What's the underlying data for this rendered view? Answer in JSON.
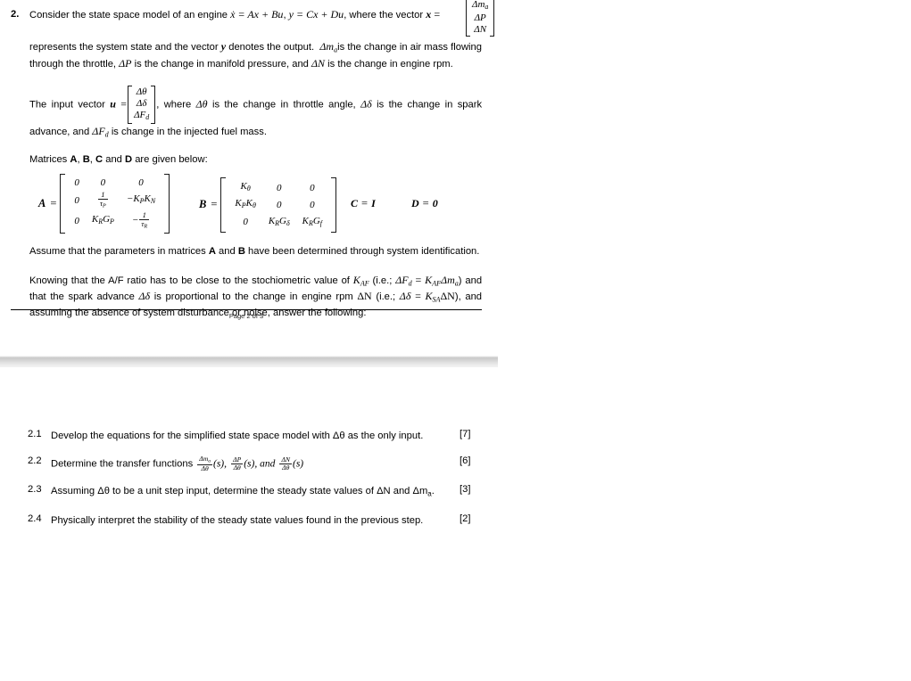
{
  "document": {
    "question_number": "2.",
    "intro": {
      "before_vector": "Consider the state space model of an engine",
      "eq1": "ẋ = Ax + Bu",
      "eq2": "y = Cx + Du",
      "after_eq": ", where the vector",
      "x_symbol": "x",
      "equals": "=",
      "state_vector": [
        "Δm",
        "ΔP",
        "ΔN"
      ],
      "state_vector_sub": "a"
    },
    "paragraph_state": {
      "text_1": "represents the system state and the vector",
      "y_symbol": "y",
      "text_2": "denotes the output.",
      "dma": "Δm",
      "dma_sub": "a",
      "text_3": "is the change in air mass flowing through the throttle,",
      "dP": "ΔP",
      "text_4": "is the change in manifold pressure, and",
      "dN": "ΔN",
      "text_5": "is the change in engine rpm."
    },
    "paragraph_input": {
      "text_1": "The input vector",
      "u_symbol": "u",
      "equals": "=",
      "input_vector": [
        "Δθ",
        "Δδ",
        "ΔF"
      ],
      "input_vector_sub": "d",
      "text_2": ", where",
      "dtheta": "Δθ",
      "text_3": "is the change in throttle angle,",
      "ddelta": "Δδ",
      "text_4": "is the change in spark advance, and",
      "dFd": "ΔF",
      "dFd_sub": "d",
      "text_5": "is change in the injected fuel mass."
    },
    "matrices_intro": {
      "text_1": "Matrices",
      "A": "A",
      "sep_1": ",",
      "B": "B",
      "sep_2": ",",
      "C": "C",
      "and": "and",
      "D": "D",
      "text_2": "are given below:"
    },
    "matrix_A": {
      "label": "A",
      "equals": "=",
      "rows": [
        [
          "0",
          "0",
          "0"
        ],
        [
          "0",
          "1/τ_P",
          "−K_P K_N"
        ],
        [
          "0",
          "K_R G_P",
          "−1/τ_R"
        ]
      ],
      "cells": {
        "r1": [
          "0",
          "0",
          "0"
        ],
        "r2c1": "0",
        "r2c2_num": "1",
        "r2c2_den": "τ",
        "r2c2_den_sub": "P",
        "r2c3": "−K",
        "r2c3_sub1": "P",
        "r2c3_b": "K",
        "r2c3_sub2": "N",
        "r3c1": "0",
        "r3c2": "K",
        "r3c2_sub1": "R",
        "r3c2_b": "G",
        "r3c2_sub2": "P",
        "r3c3_minus": "−",
        "r3c3_num": "1",
        "r3c3_den": "τ",
        "r3c3_den_sub": "R"
      }
    },
    "matrix_B": {
      "label": "B",
      "equals": "=",
      "cells": {
        "r1c1": "K",
        "r1c1_sub": "θ",
        "r1c2": "0",
        "r1c3": "0",
        "r2c1a": "K",
        "r2c1a_sub": "P",
        "r2c1b": "K",
        "r2c1b_sub": "θ",
        "r2c2": "0",
        "r2c3": "0",
        "r3c1": "0",
        "r3c2a": "K",
        "r3c2a_sub": "R",
        "r3c2b": "G",
        "r3c2b_sub": "δ",
        "r3c3a": "K",
        "r3c3a_sub": "R",
        "r3c3b": "G",
        "r3c3b_sub": "f"
      }
    },
    "matrix_C": {
      "label": "C",
      "equals": "=",
      "value": "I"
    },
    "matrix_D": {
      "label": "D",
      "equals": "=",
      "value": "0"
    },
    "paragraph_assume": {
      "text_1": "Assume that the parameters in matrices",
      "A": "A",
      "and": "and",
      "B": "B",
      "text_2": "have been determined through system identification."
    },
    "paragraph_knowing": {
      "text_1": "Knowing that the A/F ratio has to be close to the stochiometric value of",
      "K_AF": "K",
      "K_AF_sub": "AF",
      "text_2": "(i.e.;",
      "eq_dFd": "ΔF",
      "eq_dFd_sub": "d",
      "eq_equals": "=",
      "eq_KAF": "K",
      "eq_KAF_sub": "AF",
      "eq_dma": "Δm",
      "eq_dma_sub": "a",
      "text_3": ") and that the spark advance",
      "ddelta": "Δδ",
      "text_4": "is proportional to the change in engine rpm",
      "dN": "ΔN",
      "text_5": "(i.e.;",
      "eq2_ddelta": "Δδ",
      "eq2_equals": "=",
      "eq2_KSA": "K",
      "eq2_KSA_sub": "SA",
      "eq2_dN": "ΔN",
      "text_6": "), and assuming the absence of system disturbance or noise, answer the following:"
    },
    "footer": {
      "text": "Page 2 of 3"
    }
  },
  "subquestions": [
    {
      "id": "2.1",
      "text": "Develop the equations for the simplified state space model with Δθ as the only input.",
      "marks": "[7]"
    },
    {
      "id": "2.2",
      "text_before": "Determine the transfer functions",
      "fractions": [
        {
          "num": "Δm",
          "num_sub": "a",
          "den": "Δθ",
          "after": "(s),"
        },
        {
          "num": "ΔP",
          "num_sub": "",
          "den": "Δθ",
          "after": "(s), and"
        },
        {
          "num": "ΔN",
          "num_sub": "",
          "den": "Δθ",
          "after": "(s)"
        }
      ],
      "marks": "[6]"
    },
    {
      "id": "2.3",
      "text": "Assuming Δθ to be a unit step input, determine the steady state values of ΔN and Δm",
      "text_sub": "a",
      "text_end": ".",
      "marks": "[3]"
    },
    {
      "id": "2.4",
      "text": "Physically interpret the stability of the steady state values found in the previous step.",
      "marks": "[2]"
    }
  ]
}
